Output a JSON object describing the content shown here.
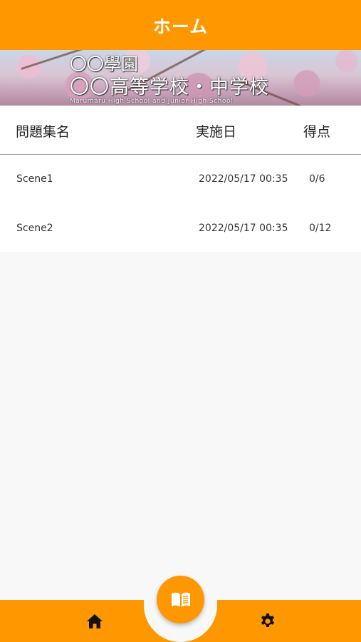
{
  "appbar": {
    "title": "ホーム"
  },
  "banner": {
    "line1": "〇〇學園",
    "line2": "〇〇高等学校・中学校",
    "line3": "Marumaru High School and Junior High School"
  },
  "table": {
    "headers": {
      "name": "問題集名",
      "date": "実施日",
      "score": "得点"
    },
    "rows": [
      {
        "name": "Scene1",
        "date": "2022/05/17 00:35",
        "score": "0/6"
      },
      {
        "name": "Scene2",
        "date": "2022/05/17 00:35",
        "score": "0/12"
      }
    ]
  },
  "nav": {
    "home_icon": "home-icon",
    "center_icon": "book-icon",
    "settings_icon": "gear-icon"
  },
  "colors": {
    "accent": "#ff9800",
    "background": "#f8f8f8"
  }
}
